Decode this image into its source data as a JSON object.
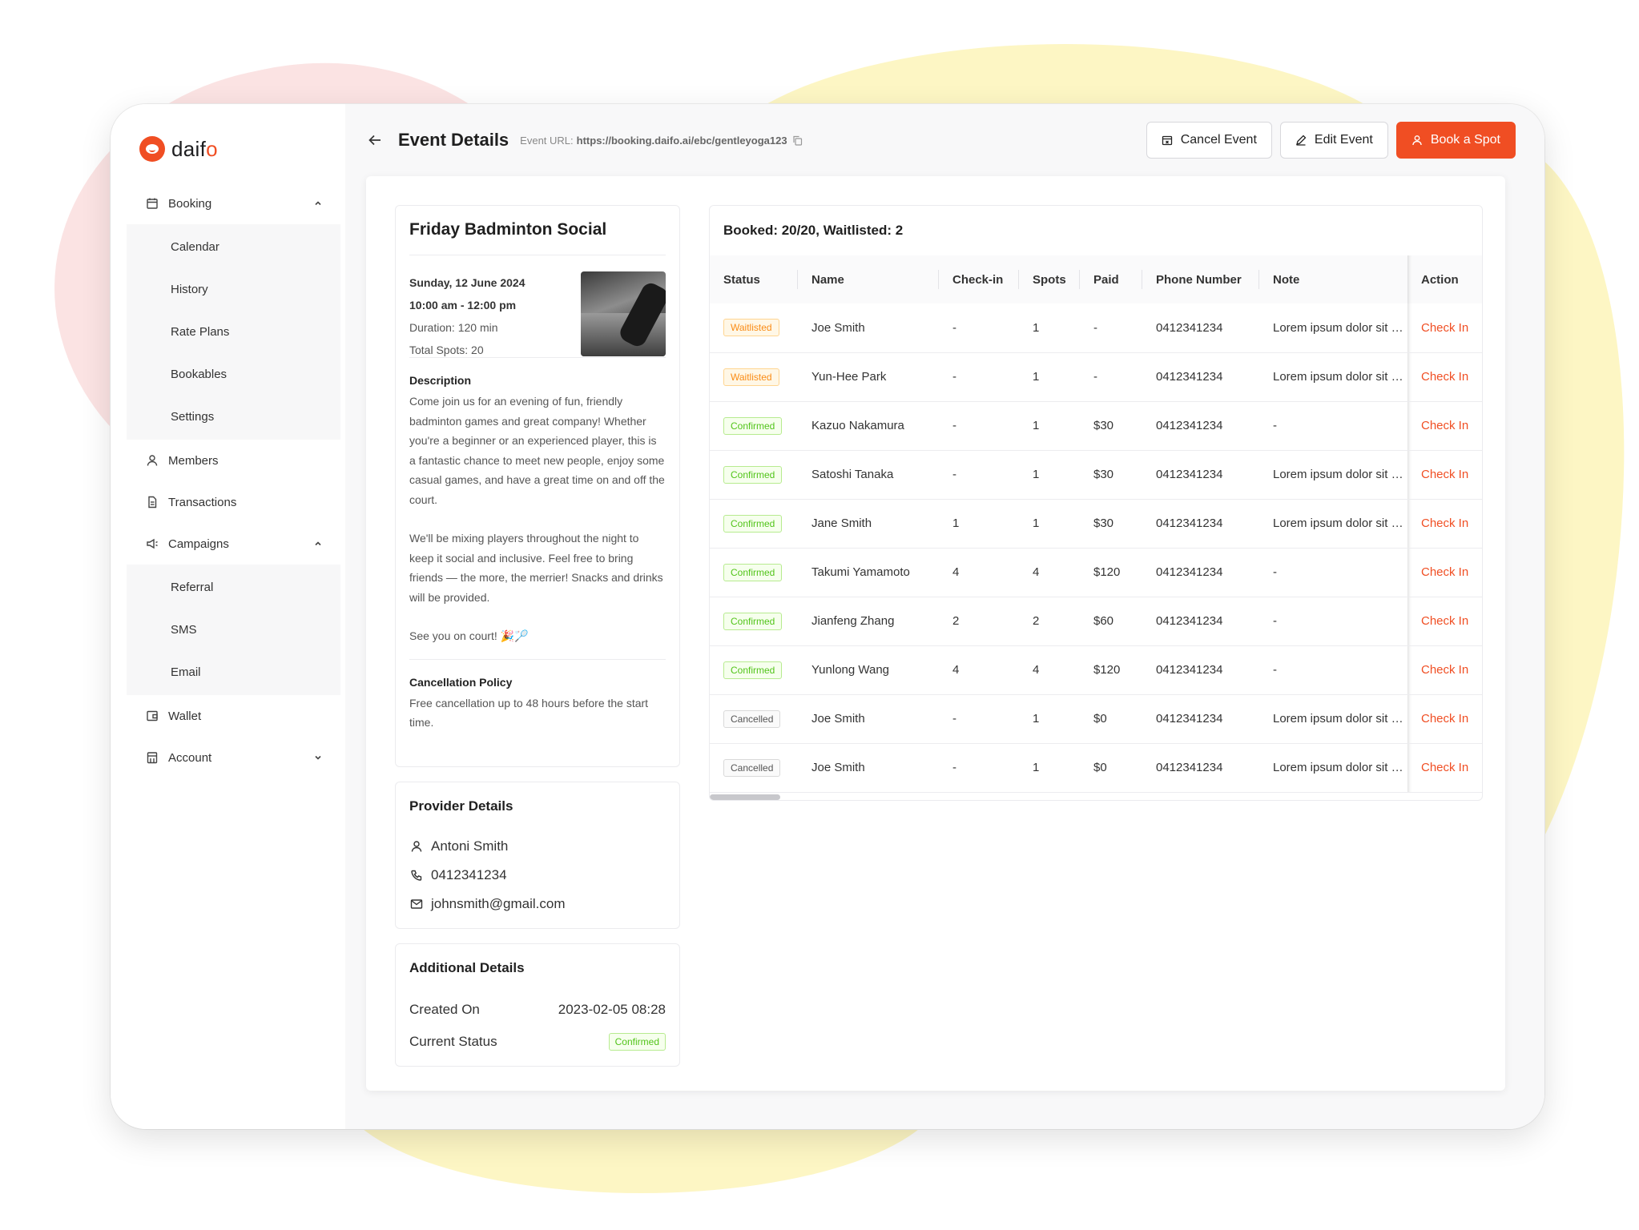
{
  "brand": {
    "name_part": "daif",
    "name_accent": "o"
  },
  "sidebar": {
    "booking": {
      "label": "Booking",
      "items": [
        "Calendar",
        "History",
        "Rate Plans",
        "Bookables",
        "Settings"
      ]
    },
    "members": "Members",
    "transactions": "Transactions",
    "campaigns": {
      "label": "Campaigns",
      "items": [
        "Referral",
        "SMS",
        "Email"
      ]
    },
    "wallet": "Wallet",
    "account": "Account"
  },
  "header": {
    "title": "Event Details",
    "url_label": "Event URL:",
    "url": "https://booking.daifo.ai/ebc/gentleyoga123",
    "cancel_label": "Cancel Event",
    "edit_label": "Edit Event",
    "book_label": "Book a Spot"
  },
  "event": {
    "title": "Friday Badminton Social",
    "date": "Sunday, 12 June 2024",
    "time": "10:00 am - 12:00 pm",
    "duration": "Duration: 120 min",
    "total_spots": "Total Spots: 20",
    "description_label": "Description",
    "description_p1": "Come join us for an evening of fun, friendly badminton games and great company! Whether you're a beginner or an experienced player, this is a fantastic chance to meet new people, enjoy some casual games, and have a great time on and off the court.",
    "description_p2": "We'll be mixing players throughout the night to keep it social and inclusive. Feel free to bring friends — the more, the merrier! Snacks and drinks will be provided.",
    "description_p3": "See you on court! 🎉🏸",
    "policy_label": "Cancellation Policy",
    "policy_text": "Free cancellation up to 48 hours before the start time."
  },
  "provider": {
    "title": "Provider Details",
    "name": "Antoni Smith",
    "phone": "0412341234",
    "email": "johnsmith@gmail.com"
  },
  "additional": {
    "title": "Additional Details",
    "created_label": "Created On",
    "created_value": "2023-02-05 08:28",
    "status_label": "Current Status",
    "status_value": "Confirmed"
  },
  "table": {
    "summary": "Booked: 20/20, Waitlisted: 2",
    "columns": [
      "Status",
      "Name",
      "Check-in",
      "Spots",
      "Paid",
      "Phone Number",
      "Note",
      "Action"
    ],
    "rows": [
      {
        "status": "Waitlisted",
        "name": "Joe Smith",
        "checkin": "-",
        "spots": "1",
        "paid": "-",
        "phone": "0412341234",
        "note": "Lorem ipsum dolor sit amet",
        "action": "Check In"
      },
      {
        "status": "Waitlisted",
        "name": "Yun-Hee Park",
        "checkin": "-",
        "spots": "1",
        "paid": "-",
        "phone": "0412341234",
        "note": "Lorem ipsum dolor sit amet",
        "action": "Check In"
      },
      {
        "status": "Confirmed",
        "name": "Kazuo Nakamura",
        "checkin": "-",
        "spots": "1",
        "paid": "$30",
        "phone": "0412341234",
        "note": "-",
        "action": "Check In"
      },
      {
        "status": "Confirmed",
        "name": "Satoshi Tanaka",
        "checkin": "-",
        "spots": "1",
        "paid": "$30",
        "phone": "0412341234",
        "note": "Lorem ipsum dolor sit amet",
        "action": "Check In"
      },
      {
        "status": "Confirmed",
        "name": "Jane Smith",
        "checkin": "1",
        "spots": "1",
        "paid": "$30",
        "phone": "0412341234",
        "note": "Lorem ipsum dolor sit amet",
        "action": "Check In"
      },
      {
        "status": "Confirmed",
        "name": "Takumi Yamamoto",
        "checkin": "4",
        "spots": "4",
        "paid": "$120",
        "phone": "0412341234",
        "note": "-",
        "action": "Check In"
      },
      {
        "status": "Confirmed",
        "name": "Jianfeng Zhang",
        "checkin": "2",
        "spots": "2",
        "paid": "$60",
        "phone": "0412341234",
        "note": "-",
        "action": "Check In"
      },
      {
        "status": "Confirmed",
        "name": "Yunlong Wang",
        "checkin": "4",
        "spots": "4",
        "paid": "$120",
        "phone": "0412341234",
        "note": "-",
        "action": "Check In"
      },
      {
        "status": "Cancelled",
        "name": "Joe Smith",
        "checkin": "-",
        "spots": "1",
        "paid": "$0",
        "phone": "0412341234",
        "note": "Lorem ipsum dolor sit amet",
        "action": "Check In"
      },
      {
        "status": "Cancelled",
        "name": "Joe Smith",
        "checkin": "-",
        "spots": "1",
        "paid": "$0",
        "phone": "0412341234",
        "note": "Lorem ipsum dolor sit amet",
        "action": "Check In"
      }
    ]
  },
  "colors": {
    "accent": "#f04e23",
    "confirmed": "#52c41a",
    "waitlisted": "#fa8c16"
  }
}
